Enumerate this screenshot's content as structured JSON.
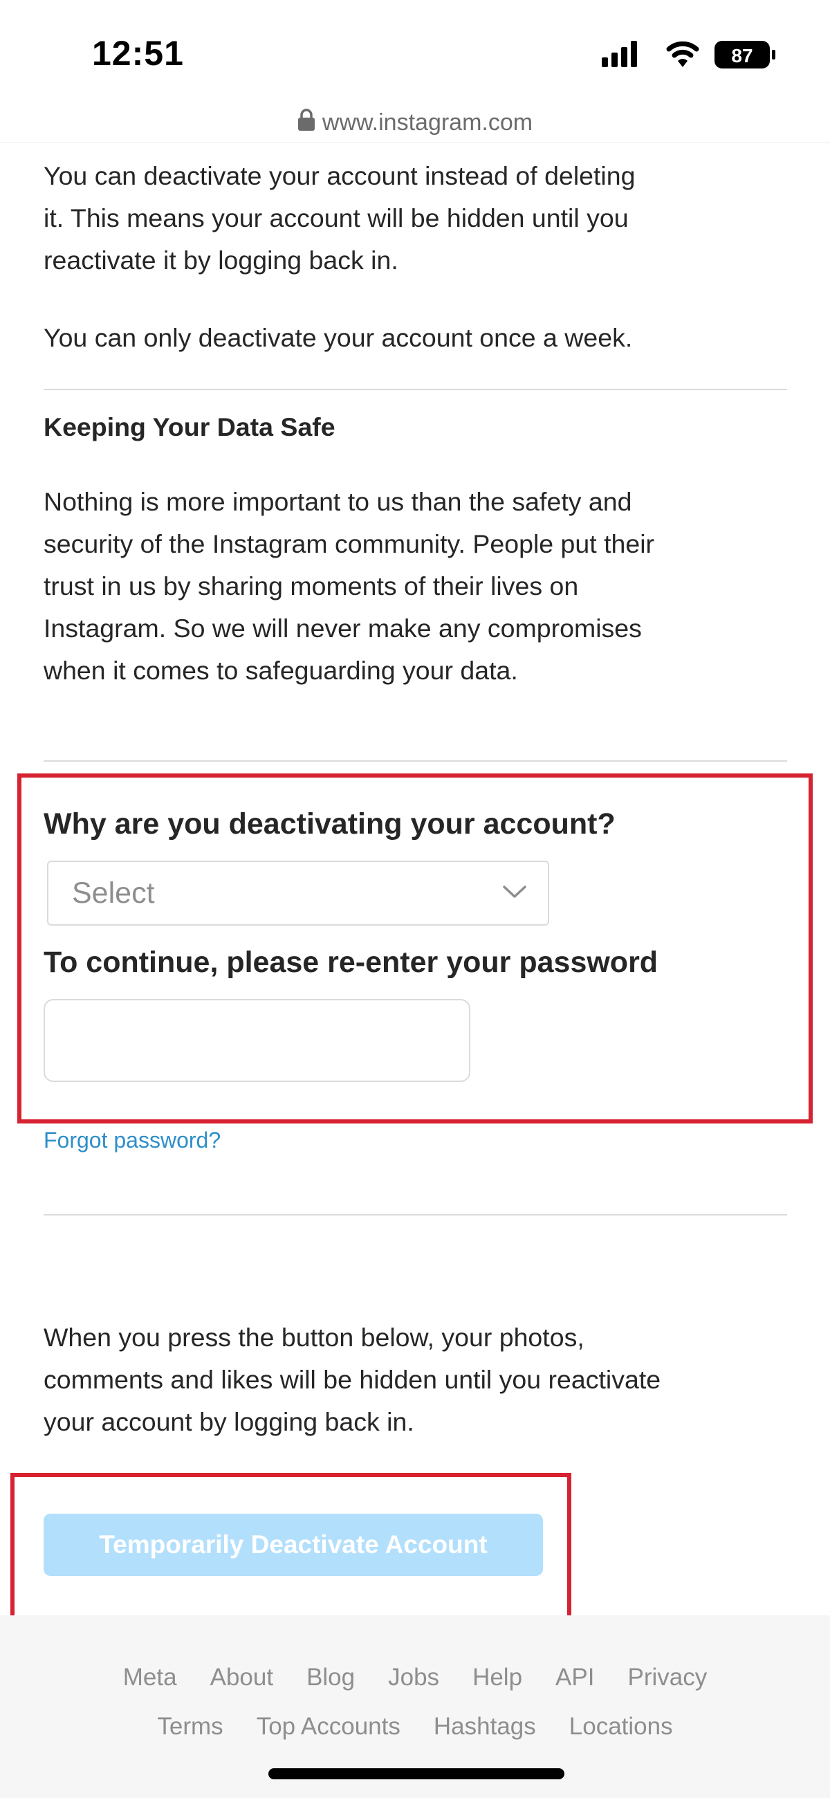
{
  "status_bar": {
    "time": "12:51",
    "battery": "87"
  },
  "browser": {
    "url": "www.instagram.com"
  },
  "deactivate_info": {
    "lines": [
      "You can deactivate your account instead of deleting",
      "it. This means your account will be hidden until you",
      "reactivate it by logging back in."
    ],
    "once_a_week": "You can only deactivate your account once a week."
  },
  "data_safe": {
    "heading": "Keeping Your Data Safe",
    "lines": [
      "Nothing is more important to us than the safety and",
      "security of the Instagram community. People put their",
      "trust in us by sharing moments of their lives on",
      "Instagram. So we will never make any compromises",
      "when it comes to safeguarding your data."
    ]
  },
  "form": {
    "reason_question": "Why are you deactivating your account?",
    "reason_select_placeholder": "Select",
    "password_prompt": "To continue, please re-enter your password",
    "password_value": "",
    "forgot_password": "Forgot password?"
  },
  "confirm": {
    "lines": [
      "When you press the button below, your photos,",
      "comments and likes will be hidden until you reactivate",
      "your account by logging back in."
    ],
    "button_label": "Temporarily Deactivate Account"
  },
  "footer": {
    "row1": [
      "Meta",
      "About",
      "Blog",
      "Jobs",
      "Help",
      "API",
      "Privacy"
    ],
    "row2": [
      "Terms",
      "Top Accounts",
      "Hashtags",
      "Locations"
    ]
  },
  "colors": {
    "highlight_border": "#d62231",
    "link": "#2e8ec9",
    "button_disabled": "#b2dffc"
  }
}
